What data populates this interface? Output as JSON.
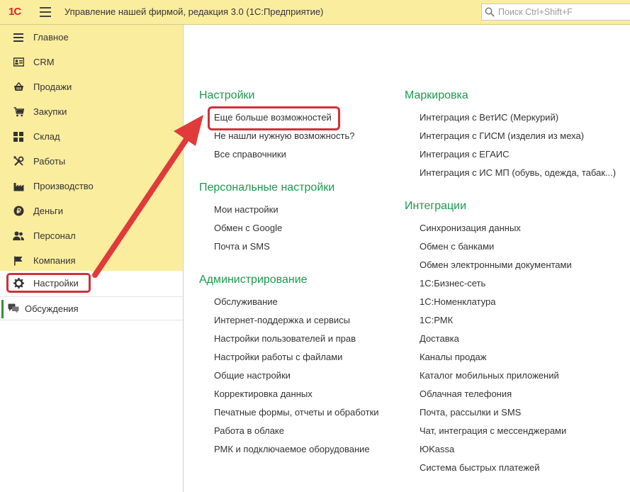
{
  "topbar": {
    "logo": "1С",
    "title": "Управление нашей фирмой, редакция 3.0  (1С:Предприятие)",
    "search_placeholder": "Поиск Ctrl+Shift+F"
  },
  "sidebar": {
    "items": [
      {
        "label": "Главное",
        "icon": "menu-lines-icon"
      },
      {
        "label": "CRM",
        "icon": "contact-card-icon"
      },
      {
        "label": "Продажи",
        "icon": "basket-icon"
      },
      {
        "label": "Закупки",
        "icon": "cart-icon"
      },
      {
        "label": "Склад",
        "icon": "grid-boxes-icon"
      },
      {
        "label": "Работы",
        "icon": "tools-icon"
      },
      {
        "label": "Производство",
        "icon": "factory-icon"
      },
      {
        "label": "Деньги",
        "icon": "coin-icon"
      },
      {
        "label": "Персонал",
        "icon": "people-icon"
      },
      {
        "label": "Компания",
        "icon": "flag-icon"
      },
      {
        "label": "Настройки",
        "icon": "gear-icon",
        "active": true
      }
    ],
    "discussions": "Обсуждения"
  },
  "content": {
    "left": [
      {
        "title": "Настройки",
        "links": [
          "Еще больше возможностей",
          "Не нашли нужную возможность?",
          "Все справочники"
        ]
      },
      {
        "title": "Персональные настройки",
        "links": [
          "Мои настройки",
          "Обмен с Google",
          "Почта и SMS"
        ]
      },
      {
        "title": "Администрирование",
        "links": [
          "Обслуживание",
          "Интернет-поддержка и сервисы",
          "Настройки пользователей и прав",
          "Настройки работы с файлами",
          "Общие настройки",
          "Корректировка данных",
          "Печатные формы, отчеты и обработки",
          "Работа в облаке",
          "РМК и подключаемое оборудование"
        ]
      }
    ],
    "right": [
      {
        "title": "Маркировка",
        "links": [
          "Интеграция с ВетИС (Меркурий)",
          "Интеграция с ГИСМ (изделия из меха)",
          "Интеграция с ЕГАИС",
          "Интеграция с ИС МП (обувь, одежда, табак...)"
        ]
      },
      {
        "title": "Интеграции",
        "links": [
          "Синхронизация данных",
          "Обмен с банками",
          "Обмен электронными документами",
          "1С:Бизнес-сеть",
          "1С:Номенклатура",
          "1С:РМК",
          "Доставка",
          "Каналы продаж",
          "Каталог мобильных приложений",
          "Облачная телефония",
          "Почта, рассылки и SMS",
          "Чат, интеграция с мессенджерами",
          "ЮKassa",
          "Система быстрых платежей"
        ]
      }
    ]
  },
  "colors": {
    "sidebar_bg": "#fbed9e",
    "section_title": "#1b9a4d",
    "annotation": "#d0303a"
  }
}
